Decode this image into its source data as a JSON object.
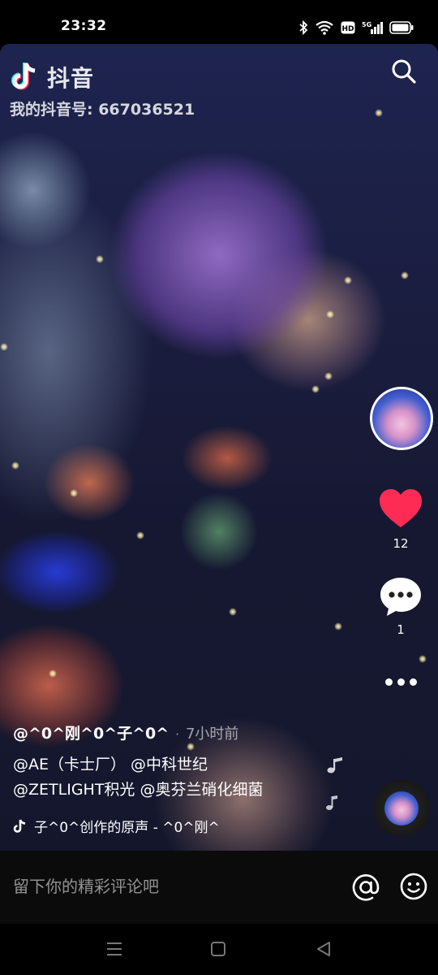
{
  "status_bar": {
    "time": "23:32",
    "icons": [
      "bluetooth-icon",
      "wifi-icon",
      "hd-icon",
      "5g-signal-icon",
      "battery-icon"
    ],
    "hd_label": "HD",
    "network_label": "5G"
  },
  "watermark": {
    "brand": "抖音",
    "douyin_id": "我的抖音号: 667036521"
  },
  "actions": {
    "like_count": "12",
    "comment_count": "1"
  },
  "post": {
    "author": "@^0^刚^0^子^0^",
    "separator": "·",
    "time_ago": "7小时前",
    "caption_line1": "@AE（卡士厂） @中科世纪",
    "caption_line2": "@ZETLIGHT积光 @奥芬兰硝化细菌",
    "music": "子^0^创作的原声 - ^0^刚^"
  },
  "comment_bar": {
    "placeholder": "留下你的精彩评论吧"
  },
  "colors": {
    "like_red": "#fe2c55",
    "background": "#000000"
  }
}
